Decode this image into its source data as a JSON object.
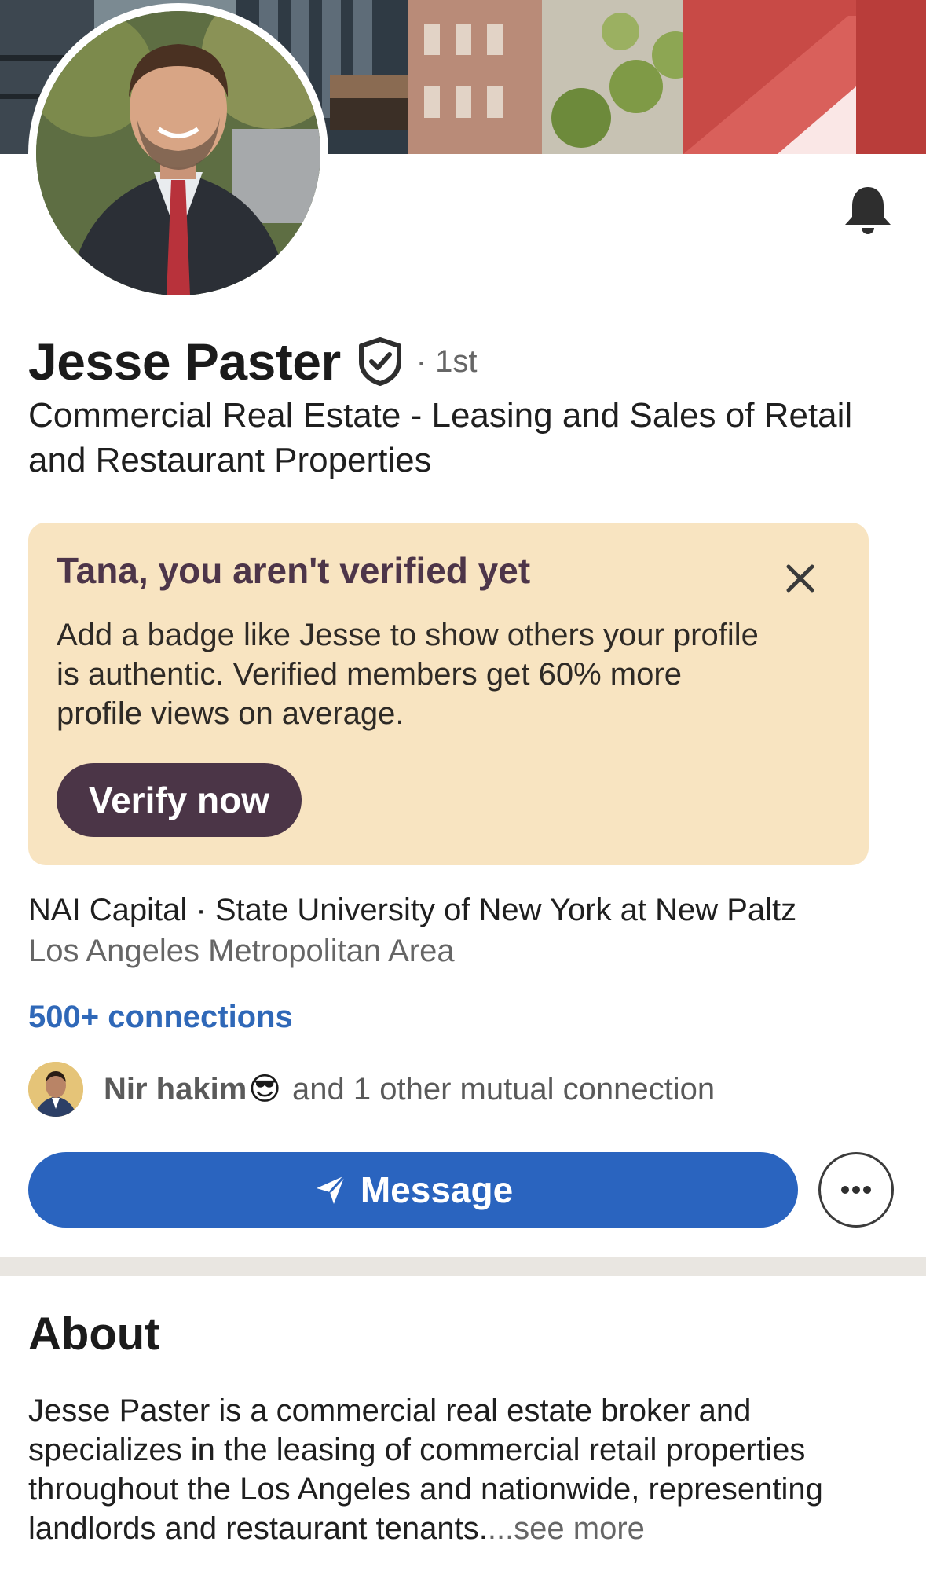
{
  "profile": {
    "name": "Jesse Paster",
    "degree": "· 1st",
    "headline": "Commercial Real Estate - Leasing and Sales of Retail and Restaurant Properties",
    "organization": "NAI Capital · State University of New York at New Paltz",
    "location": "Los Angeles Metropolitan Area",
    "connections": "500+ connections"
  },
  "mutual": {
    "name": "Nir hakim",
    "emoji": "😎",
    "rest": "and 1 other mutual connection"
  },
  "banner": {
    "title": "Tana, you aren't verified yet",
    "body": "Add a badge like Jesse to show others your profile is authentic. Verified members get 60% more profile views on average.",
    "button": "Verify now"
  },
  "actions": {
    "message": "Message"
  },
  "about": {
    "title": "About",
    "text": "Jesse Paster is a commercial real estate broker and specializes in the leasing of commercial retail properties throughout the Los Angeles and nationwide, representing landlords and restaurant tenants.",
    "see_more": "...see more"
  },
  "icons": {
    "bell": "bell-icon",
    "verified": "verified-shield-icon",
    "close": "close-icon",
    "send": "send-icon",
    "more": "more-icon"
  },
  "colors": {
    "primary_blue": "#2a64bf",
    "link_blue": "#2f68b8",
    "banner_bg": "#f8e4c1",
    "banner_accent": "#4b3547"
  }
}
